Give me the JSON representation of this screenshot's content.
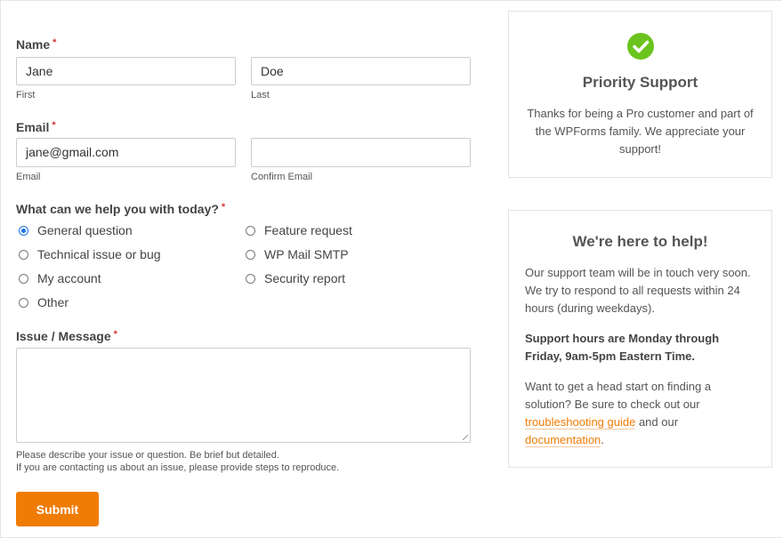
{
  "form": {
    "name_label": "Name",
    "required_mark": "*",
    "first_value": "Jane",
    "first_sublabel": "First",
    "last_value": "Doe",
    "last_sublabel": "Last",
    "email_label": "Email",
    "email_value": "jane@gmail.com",
    "email_sublabel": "Email",
    "confirm_email_value": "",
    "confirm_email_sublabel": "Confirm Email",
    "help_label": "What can we help you with today?",
    "options": [
      {
        "label": "General question",
        "selected": true
      },
      {
        "label": "Technical issue or bug",
        "selected": false
      },
      {
        "label": "My account",
        "selected": false
      },
      {
        "label": "Other",
        "selected": false
      },
      {
        "label": "Feature request",
        "selected": false
      },
      {
        "label": "WP Mail SMTP",
        "selected": false
      },
      {
        "label": "Security report",
        "selected": false
      }
    ],
    "message_label": "Issue / Message",
    "message_value": "",
    "message_help_1": "Please describe your issue or question. Be brief but detailed.",
    "message_help_2": "If you are contacting us about an issue, please provide steps to reproduce.",
    "submit_label": "Submit"
  },
  "priority_card": {
    "icon": "check-circle-icon",
    "icon_color": "#6bc41d",
    "title": "Priority Support",
    "text": "Thanks for being a Pro customer and part of the WPForms family. We appreciate your support!"
  },
  "help_card": {
    "title": "We're here to help!",
    "para1": "Our support team will be in touch very soon. We try to respond to all requests within 24 hours (during weekdays).",
    "para2": "Support hours are Monday through Friday, 9am-5pm Eastern Time.",
    "para3_pre": "Want to get a head start on finding a solution? Be sure to check out our ",
    "link1": "troubleshooting guide",
    "para3_mid": " and our ",
    "link2": "documentation",
    "para3_end": "."
  },
  "colors": {
    "accent": "#f07c05",
    "required": "#d63638",
    "radio_selected": "#1a73e8"
  }
}
